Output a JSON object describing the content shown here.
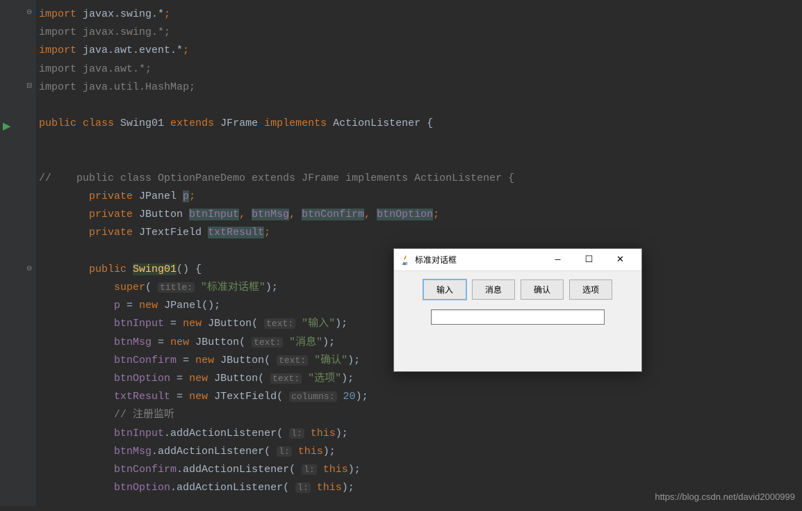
{
  "code": {
    "l1": {
      "kw": "import",
      "nm": " javax.swing.*",
      "sc": ";"
    },
    "l2": {
      "kw": "import",
      "nm": " javax.swing.*",
      "sc": ";"
    },
    "l3": {
      "kw": "import",
      "nm": " java.awt.event.*",
      "sc": ";"
    },
    "l4": {
      "kw": "import",
      "nm": " java.awt.*",
      "sc": ";"
    },
    "l5": {
      "kw": "import",
      "nm": " java.util.HashMap",
      "sc": ";"
    },
    "l7": {
      "public": "public ",
      "class": "class ",
      "name": "Swing01 ",
      "extends": "extends ",
      "parent": "JFrame ",
      "implements": "implements ",
      "iface": "ActionListener {"
    },
    "l10": "//    public class OptionPaneDemo extends JFrame implements ActionListener {",
    "l11": {
      "priv": "private ",
      "type": "JPanel ",
      "f": "p",
      "sc": ";"
    },
    "l12": {
      "priv": "private ",
      "type": "JButton ",
      "f1": "btnInput",
      "c1": ", ",
      "f2": "btnMsg",
      "c2": ", ",
      "f3": "btnConfirm",
      "c3": ", ",
      "f4": "btnOption",
      "sc": ";"
    },
    "l13": {
      "priv": "private ",
      "type": "JTextField ",
      "f": "txtResult",
      "sc": ";"
    },
    "l15": {
      "public": "public ",
      "name": "Swing01",
      "paren": "() {"
    },
    "l16": {
      "super": "super",
      "open": "( ",
      "hint": "title:",
      "sp": " ",
      "str": "\"标准对话框\"",
      "close": ");"
    },
    "l17": {
      "f": "p",
      "eq": " = ",
      "new": "new ",
      "call": "JPanel();"
    },
    "l18": {
      "f": "btnInput",
      "eq": " = ",
      "new": "new ",
      "type": "JButton",
      "open": "( ",
      "hint": "text:",
      "sp": " ",
      "str": "\"输入\"",
      "close": ");"
    },
    "l19": {
      "f": "btnMsg",
      "eq": " = ",
      "new": "new ",
      "type": "JButton",
      "open": "( ",
      "hint": "text:",
      "sp": " ",
      "str": "\"消息\"",
      "close": ");"
    },
    "l20": {
      "f": "btnConfirm",
      "eq": " = ",
      "new": "new ",
      "type": "JButton",
      "open": "( ",
      "hint": "text:",
      "sp": " ",
      "str": "\"确认\"",
      "close": ");"
    },
    "l21": {
      "f": "btnOption",
      "eq": " = ",
      "new": "new ",
      "type": "JButton",
      "open": "( ",
      "hint": "text:",
      "sp": " ",
      "str": "\"选项\"",
      "close": ");"
    },
    "l22": {
      "f": "txtResult",
      "eq": " = ",
      "new": "new ",
      "type": "JTextField",
      "open": "( ",
      "hint": "columns:",
      "sp": " ",
      "num": "20",
      "close": ");"
    },
    "l23": "// 注册监听",
    "l24": {
      "f": "btnInput",
      "call": ".addActionListener( ",
      "hint": "l:",
      "sp": " ",
      "this": "this",
      "close": ");"
    },
    "l25": {
      "f": "btnMsg",
      "call": ".addActionListener( ",
      "hint": "l:",
      "sp": " ",
      "this": "this",
      "close": ");"
    },
    "l26": {
      "f": "btnConfirm",
      "call": ".addActionListener( ",
      "hint": "l:",
      "sp": " ",
      "this": "this",
      "close": ");"
    },
    "l27": {
      "f": "btnOption",
      "call": ".addActionListener( ",
      "hint": "l:",
      "sp": " ",
      "this": "this",
      "close": ");"
    }
  },
  "dialog": {
    "title": "标准对话框",
    "buttons": {
      "input": "输入",
      "msg": "消息",
      "confirm": "确认",
      "option": "选项"
    }
  },
  "watermark": "https://blog.csdn.net/david2000999"
}
